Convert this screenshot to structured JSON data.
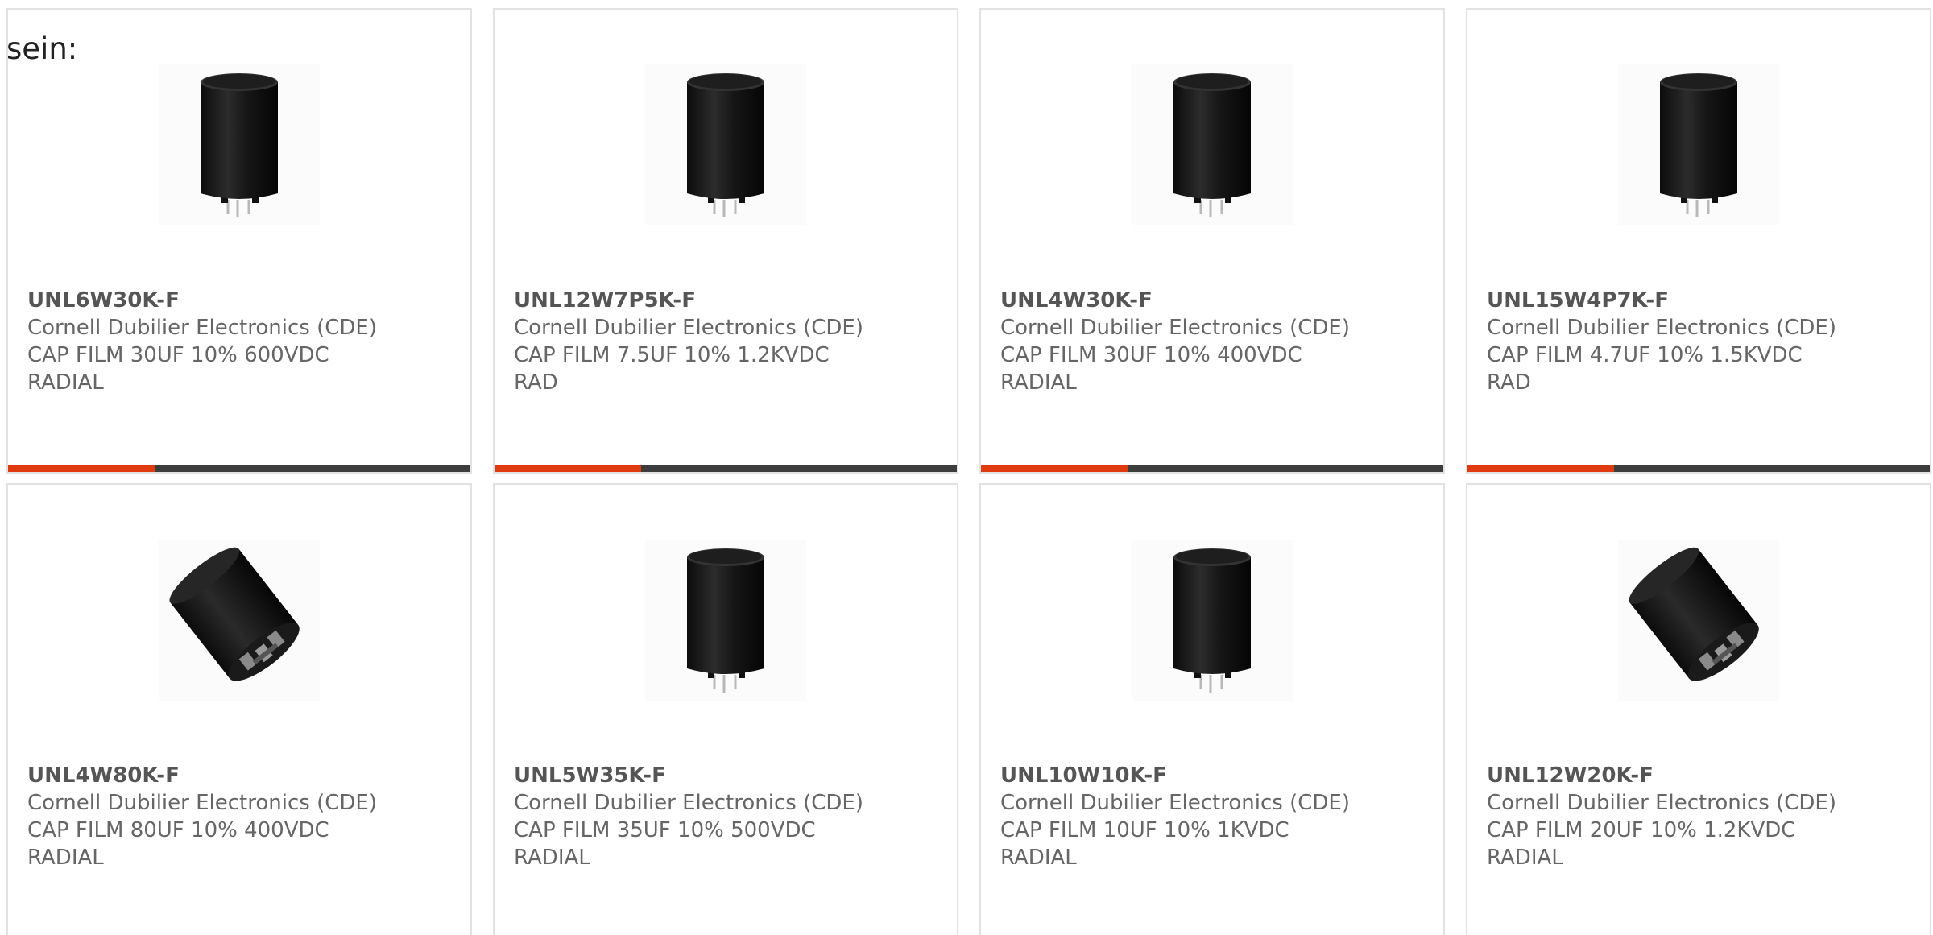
{
  "intro_text": "sein:",
  "accent_color": "#e03a10",
  "bar_color": "#3d3d3d",
  "products": [
    {
      "part_number": "UNL6W30K-F",
      "manufacturer": "Cornell Dubilier Electronics (CDE)",
      "description_line1": "CAP FILM 30UF 10% 600VDC",
      "description_line2": "RADIAL",
      "image_icon": "cylindrical-film-capacitor-upright-icon"
    },
    {
      "part_number": "UNL12W7P5K-F",
      "manufacturer": "Cornell Dubilier Electronics (CDE)",
      "description_line1": "CAP FILM 7.5UF 10% 1.2KVDC",
      "description_line2": "RAD",
      "image_icon": "cylindrical-film-capacitor-upright-icon"
    },
    {
      "part_number": "UNL4W30K-F",
      "manufacturer": "Cornell Dubilier Electronics (CDE)",
      "description_line1": "CAP FILM 30UF 10% 400VDC",
      "description_line2": "RADIAL",
      "image_icon": "cylindrical-film-capacitor-upright-icon"
    },
    {
      "part_number": "UNL15W4P7K-F",
      "manufacturer": "Cornell Dubilier Electronics (CDE)",
      "description_line1": "CAP FILM 4.7UF 10% 1.5KVDC",
      "description_line2": "RAD",
      "image_icon": "cylindrical-film-capacitor-upright-icon"
    },
    {
      "part_number": "UNL4W80K-F",
      "manufacturer": "Cornell Dubilier Electronics (CDE)",
      "description_line1": "CAP FILM 80UF 10% 400VDC",
      "description_line2": "RADIAL",
      "image_icon": "cylindrical-film-capacitor-tilted-icon"
    },
    {
      "part_number": "UNL5W35K-F",
      "manufacturer": "Cornell Dubilier Electronics (CDE)",
      "description_line1": "CAP FILM 35UF 10% 500VDC",
      "description_line2": "RADIAL",
      "image_icon": "cylindrical-film-capacitor-upright-icon"
    },
    {
      "part_number": "UNL10W10K-F",
      "manufacturer": "Cornell Dubilier Electronics (CDE)",
      "description_line1": "CAP FILM 10UF 10% 1KVDC",
      "description_line2": "RADIAL",
      "image_icon": "cylindrical-film-capacitor-upright-icon"
    },
    {
      "part_number": "UNL12W20K-F",
      "manufacturer": "Cornell Dubilier Electronics (CDE)",
      "description_line1": "CAP FILM 20UF 10% 1.2KVDC",
      "description_line2": "RADIAL",
      "image_icon": "cylindrical-film-capacitor-tilted-icon"
    }
  ]
}
